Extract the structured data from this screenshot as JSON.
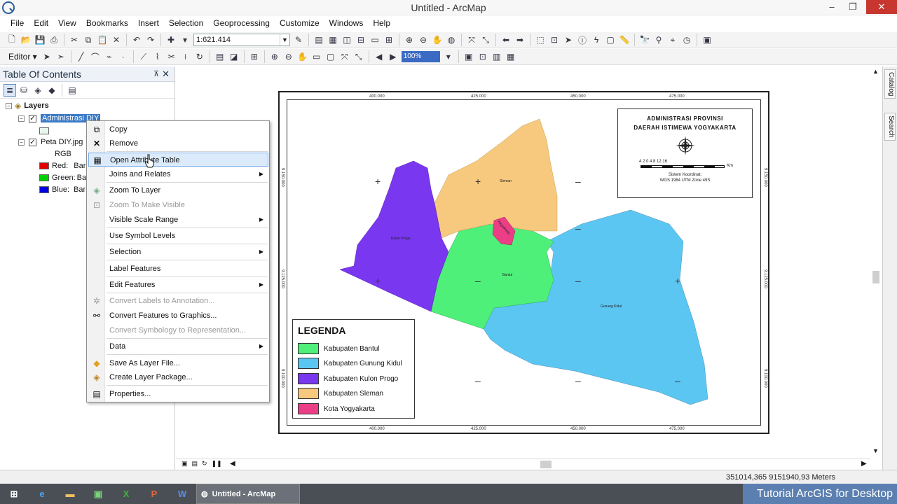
{
  "window": {
    "title": "Untitled - ArcMap",
    "minimize": "–",
    "restore": "❐",
    "close": "✕"
  },
  "menu": [
    "File",
    "Edit",
    "View",
    "Bookmarks",
    "Insert",
    "Selection",
    "Geoprocessing",
    "Customize",
    "Windows",
    "Help"
  ],
  "toolbar": {
    "scale": "1:621.414",
    "editor": "Editor ▾",
    "pct": "100%"
  },
  "toc": {
    "title": "Table Of Contents",
    "pin": "⊼",
    "close": "✕",
    "layers_root": "Layers",
    "layer1": "Administrasi DIY",
    "layer2": "Peta DIY.jpg",
    "rgb": "RGB",
    "red": "Red:",
    "green": "Green:",
    "blue": "Blue:",
    "band": "Bar"
  },
  "context_menu": {
    "copy": "Copy",
    "remove": "Remove",
    "open_attr": "Open Attribute Table",
    "joins": "Joins and Relates",
    "zoom_layer": "Zoom To Layer",
    "zoom_visible": "Zoom To Make Visible",
    "visible_scale": "Visible Scale Range",
    "symbol_levels": "Use Symbol Levels",
    "selection": "Selection",
    "label_features": "Label Features",
    "edit_features": "Edit Features",
    "convert_labels": "Convert Labels to Annotation...",
    "convert_features": "Convert Features to Graphics...",
    "convert_symbology": "Convert Symbology to Representation...",
    "data": "Data",
    "save_layer": "Save As Layer File...",
    "create_package": "Create Layer Package...",
    "properties": "Properties..."
  },
  "map": {
    "title_line1": "ADMINISTRASI PROVINSI",
    "title_line2": "DAERAH ISTIMEWA YOGYAKARTA",
    "scale_labels": "4  2  0  4  8  12  16",
    "scale_unit": "Km",
    "coord_system_1": "Sistem Koordinat:",
    "coord_system_2": "WGS 1984 UTM Zone 49S",
    "ticks_x": [
      "400.000",
      "425.000",
      "450.000",
      "475.000"
    ],
    "ticks_y": [
      "9.150.000",
      "9.125.000",
      "9.100.000"
    ],
    "legend_title": "LEGENDA",
    "legend": [
      {
        "label": "Kabupaten Bantul",
        "color": "#4ef07a"
      },
      {
        "label": "Kabupaten Gunung Kidul",
        "color": "#5cc6f2"
      },
      {
        "label": "Kabupaten Kulon Progo",
        "color": "#7a37f0"
      },
      {
        "label": "Kabupaten Sleman",
        "color": "#f6c97e"
      },
      {
        "label": "Kota Yogyakarta",
        "color": "#ec3e86"
      }
    ],
    "regions": {
      "sleman": "Sleman",
      "kulon_progo": "Kulon Progo",
      "bantul": "Bantul",
      "gunung_kidul": "Gunung Kidul",
      "yogya": "Yogyakarta"
    }
  },
  "right_tabs": {
    "catalog": "Catalog",
    "search": "Search"
  },
  "status": {
    "coords": "351014,365  9151940,93 Meters"
  },
  "taskbar": {
    "active_app": "Untitled - ArcMap",
    "tutorial": "Tutorial ArcGIS for Desktop"
  }
}
